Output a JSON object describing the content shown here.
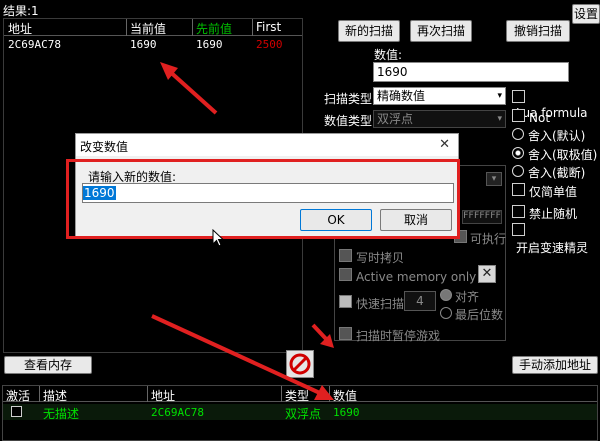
{
  "window": {
    "results_label": "结果:1",
    "settings_label": "设置"
  },
  "results_table": {
    "columns": [
      "地址",
      "当前值",
      "先前值",
      "First"
    ],
    "rows": [
      {
        "address": "2C69AC78",
        "current": "1690",
        "previous": "1690",
        "first": "2500"
      }
    ]
  },
  "scan_buttons": {
    "new_scan": "新的扫描",
    "next_scan": "再次扫描",
    "undo_scan": "撤销扫描"
  },
  "value_panel": {
    "value_label": "数值:",
    "value_input": "1690",
    "scan_type_label": "扫描类型",
    "scan_type_value": "精确数值",
    "value_type_label": "数值类型",
    "value_type_value": "双浮点"
  },
  "right_options": {
    "lua_formula": "Lua formula",
    "not": "Not",
    "round_default": "舍入(默认)",
    "round_extreme": "舍入(取极值)",
    "round_truncate": "舍入(截断)",
    "simple_only": "仅简单值",
    "disable_random": "禁止随机",
    "speedhack": "开启变速精灵"
  },
  "memory_options": {
    "hex_partial": "FFFFFFF",
    "executable": "可执行",
    "copy_on_write": "写时拷贝",
    "active_memory_only": "Active memory only",
    "fast_scan": "快速扫描",
    "fast_scan_value": "4",
    "align": "对齐",
    "last_digits": "最后位数",
    "pause_game": "扫描时暂停游戏"
  },
  "bottom": {
    "view_memory": "查看内存",
    "add_address_manually": "手动添加地址"
  },
  "address_list": {
    "columns": [
      "激活",
      "描述",
      "地址",
      "类型",
      "数值"
    ],
    "rows": [
      {
        "description": "无描述",
        "address": "2C69AC78",
        "type": "双浮点",
        "value": "1690"
      }
    ]
  },
  "dialog": {
    "title": "改变数值",
    "close_glyph": "✕",
    "prompt": "请输入新的数值:",
    "input_value": "1690",
    "ok_label": "OK",
    "cancel_label": "取消"
  },
  "colors": {
    "previous_header": "#00c000",
    "first_value": "#d00000",
    "highlight_box": "#e02020",
    "row_text": "#00e000"
  }
}
